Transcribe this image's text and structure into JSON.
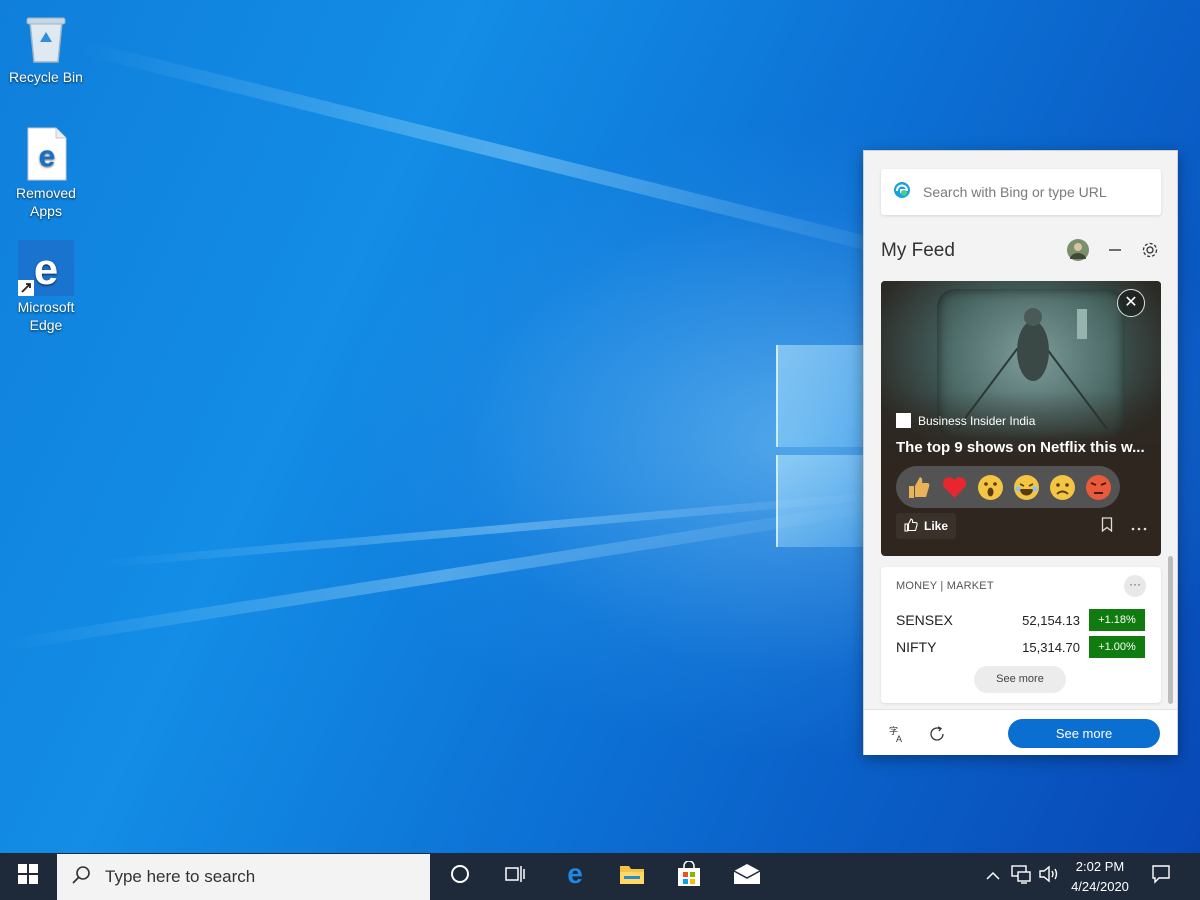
{
  "desktop": {
    "icons": [
      {
        "label": "Recycle Bin"
      },
      {
        "label": "Removed Apps"
      },
      {
        "label": "Microsoft Edge"
      }
    ]
  },
  "feed": {
    "search_placeholder": "Search with Bing or type URL",
    "title": "My Feed",
    "news": {
      "source": "Business Insider India",
      "headline": "The top 9 shows on Netflix this w...",
      "like_label": "Like"
    },
    "market": {
      "label": "MONEY | MARKET",
      "rows": [
        {
          "name": "SENSEX",
          "value": "52,154.13",
          "change": "+1.18%"
        },
        {
          "name": "NIFTY",
          "value": "15,314.70",
          "change": "+1.00%"
        }
      ],
      "see_more": "See more"
    },
    "footer_see_more": "See more"
  },
  "taskbar": {
    "search_placeholder": "Type here to search",
    "time": "2:02 PM",
    "date": "4/24/2020"
  },
  "colors": {
    "accent": "#0a6fd0",
    "positive": "#107c10",
    "taskbar": "#1e2a3a"
  }
}
